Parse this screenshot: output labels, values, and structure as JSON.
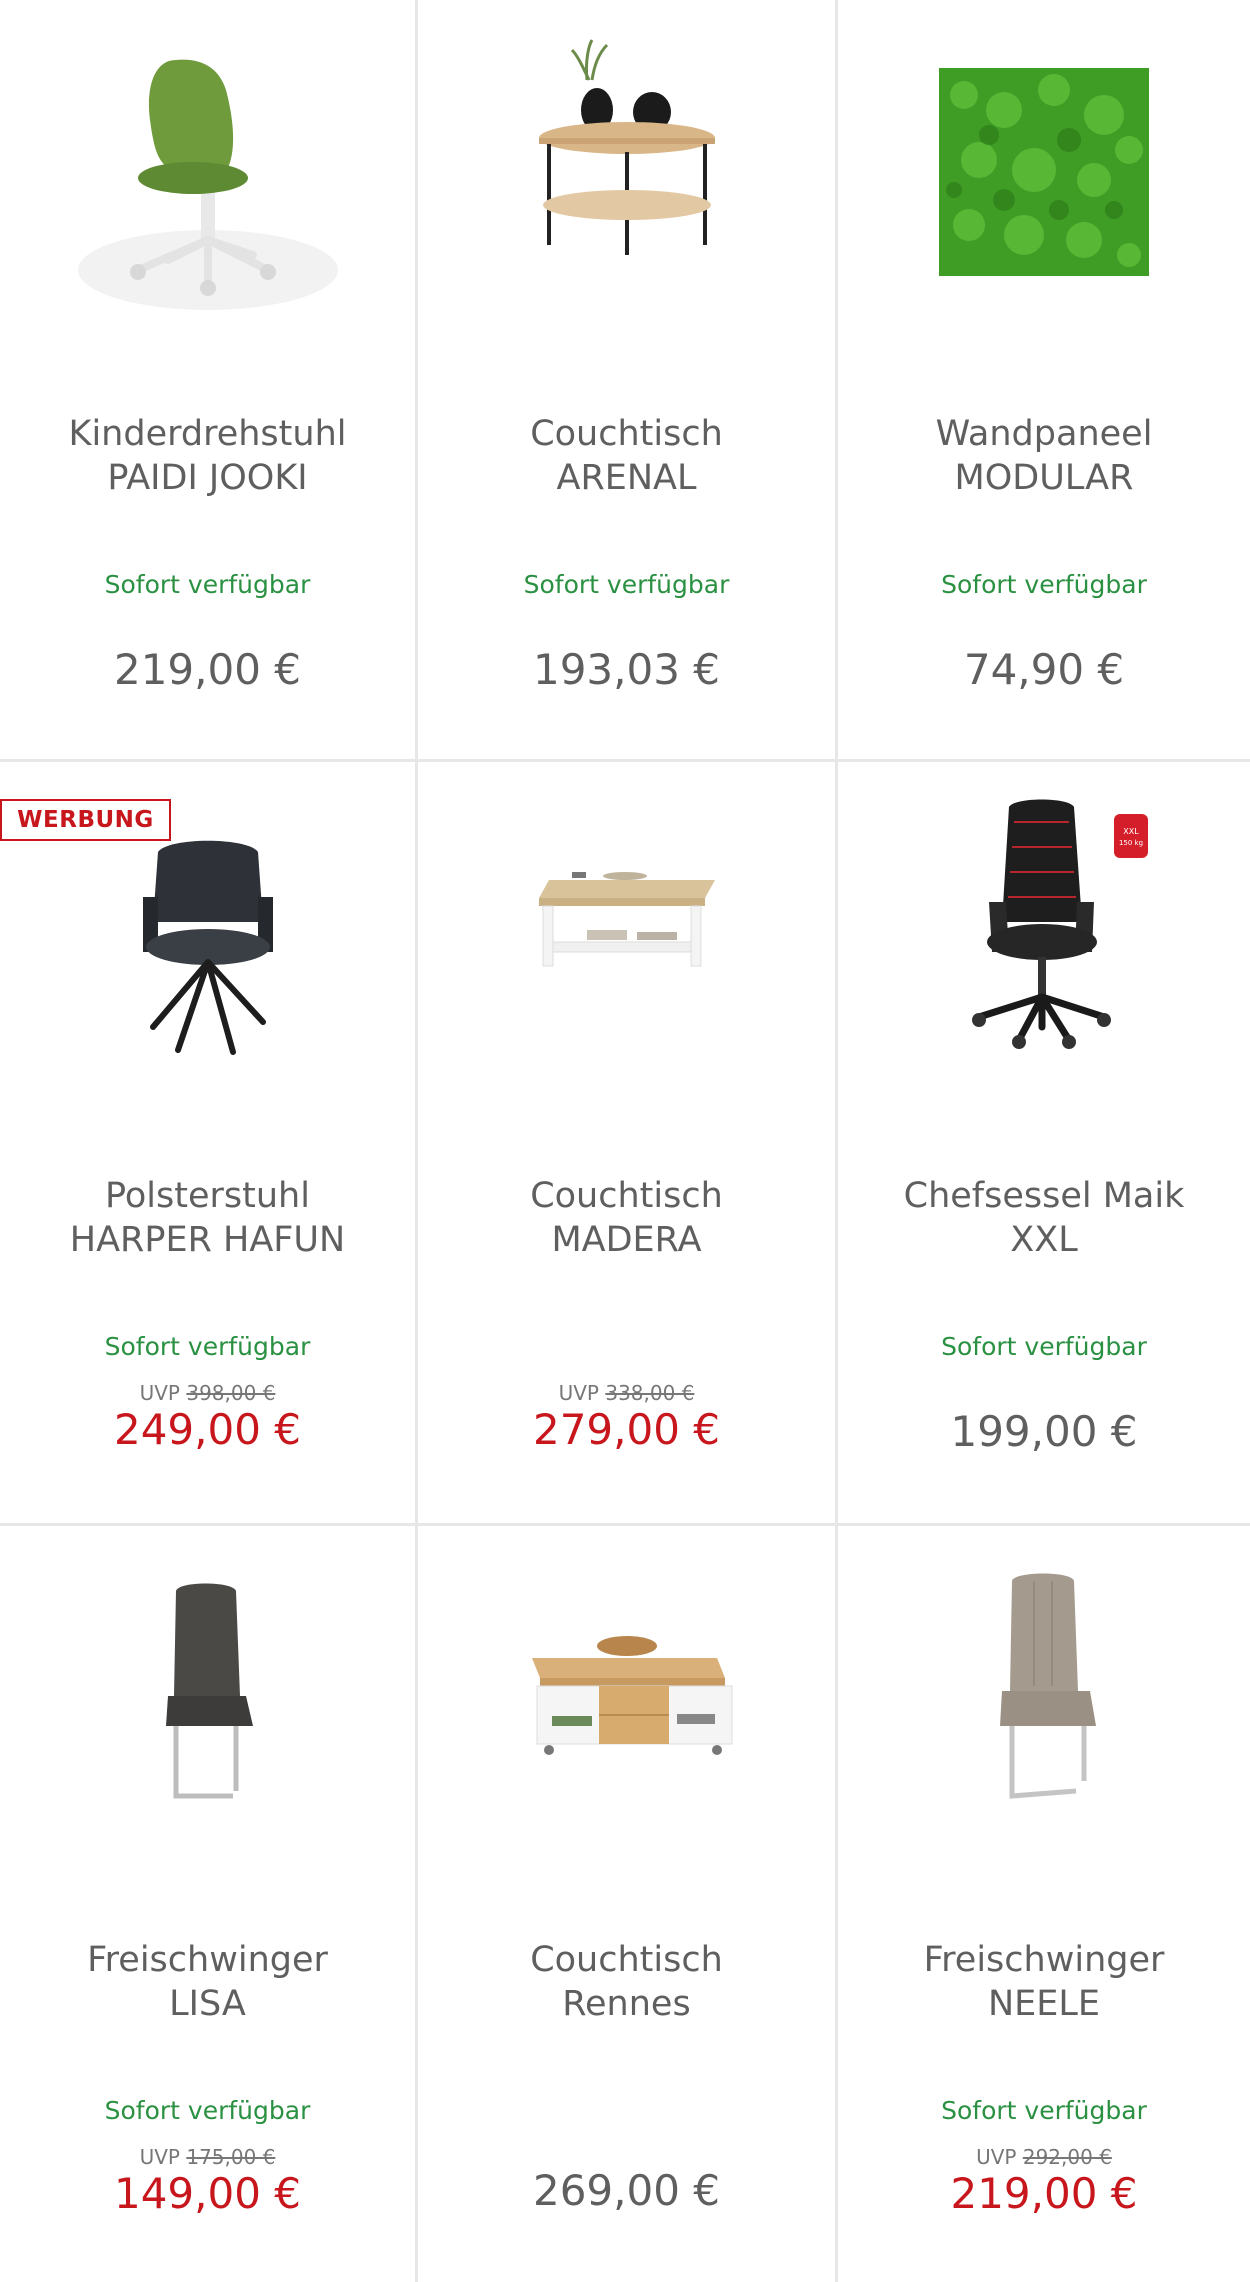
{
  "products": [
    {
      "title_line1": "Kinderdrehstuhl",
      "title_line2": "PAIDI JOOKI",
      "availability": "Sofort verfügbar",
      "price": "219,00 €",
      "image": "green-kids-chair"
    },
    {
      "title_line1": "Couchtisch",
      "title_line2": "ARENAL",
      "availability": "Sofort verfügbar",
      "price": "193,03 €",
      "image": "round-coffee-table"
    },
    {
      "title_line1": "Wandpaneel",
      "title_line2": "MODULAR",
      "availability": "Sofort verfügbar",
      "price": "74,90 €",
      "image": "moss-wall-panel"
    },
    {
      "title_line1": "Polsterstuhl",
      "title_line2": "HARPER HAFUN",
      "availability": "Sofort verfügbar",
      "uvp_label": "UVP",
      "uvp_price": "398,00 €",
      "price": "249,00 €",
      "badge": "WERBUNG",
      "image": "dark-upholstered-chair"
    },
    {
      "title_line1": "Couchtisch",
      "title_line2": "MADERA",
      "uvp_label": "UVP",
      "uvp_price": "338,00 €",
      "price": "279,00 €",
      "image": "white-oak-coffee-table"
    },
    {
      "title_line1": "Chefsessel Maik",
      "title_line2": "XXL",
      "availability": "Sofort verfügbar",
      "price": "199,00 €",
      "image": "black-gaming-office-chair"
    },
    {
      "title_line1": "Freischwinger",
      "title_line2": "LISA",
      "availability": "Sofort verfügbar",
      "uvp_label": "UVP",
      "uvp_price": "175,00 €",
      "price": "149,00 €",
      "image": "anthracite-cantilever-chair"
    },
    {
      "title_line1": "Couchtisch",
      "title_line2": "Rennes",
      "price": "269,00 €",
      "image": "oak-white-coffee-table"
    },
    {
      "title_line1": "Freischwinger",
      "title_line2": "NEELE",
      "availability": "Sofort verfügbar",
      "uvp_label": "UVP",
      "uvp_price": "292,00 €",
      "price": "219,00 €",
      "image": "taupe-cantilever-chair"
    }
  ],
  "colors": {
    "availability": "#2b9142",
    "sale_price": "#c8161d",
    "regular_price": "#5f5f5f",
    "divider": "#e7e7e7"
  }
}
